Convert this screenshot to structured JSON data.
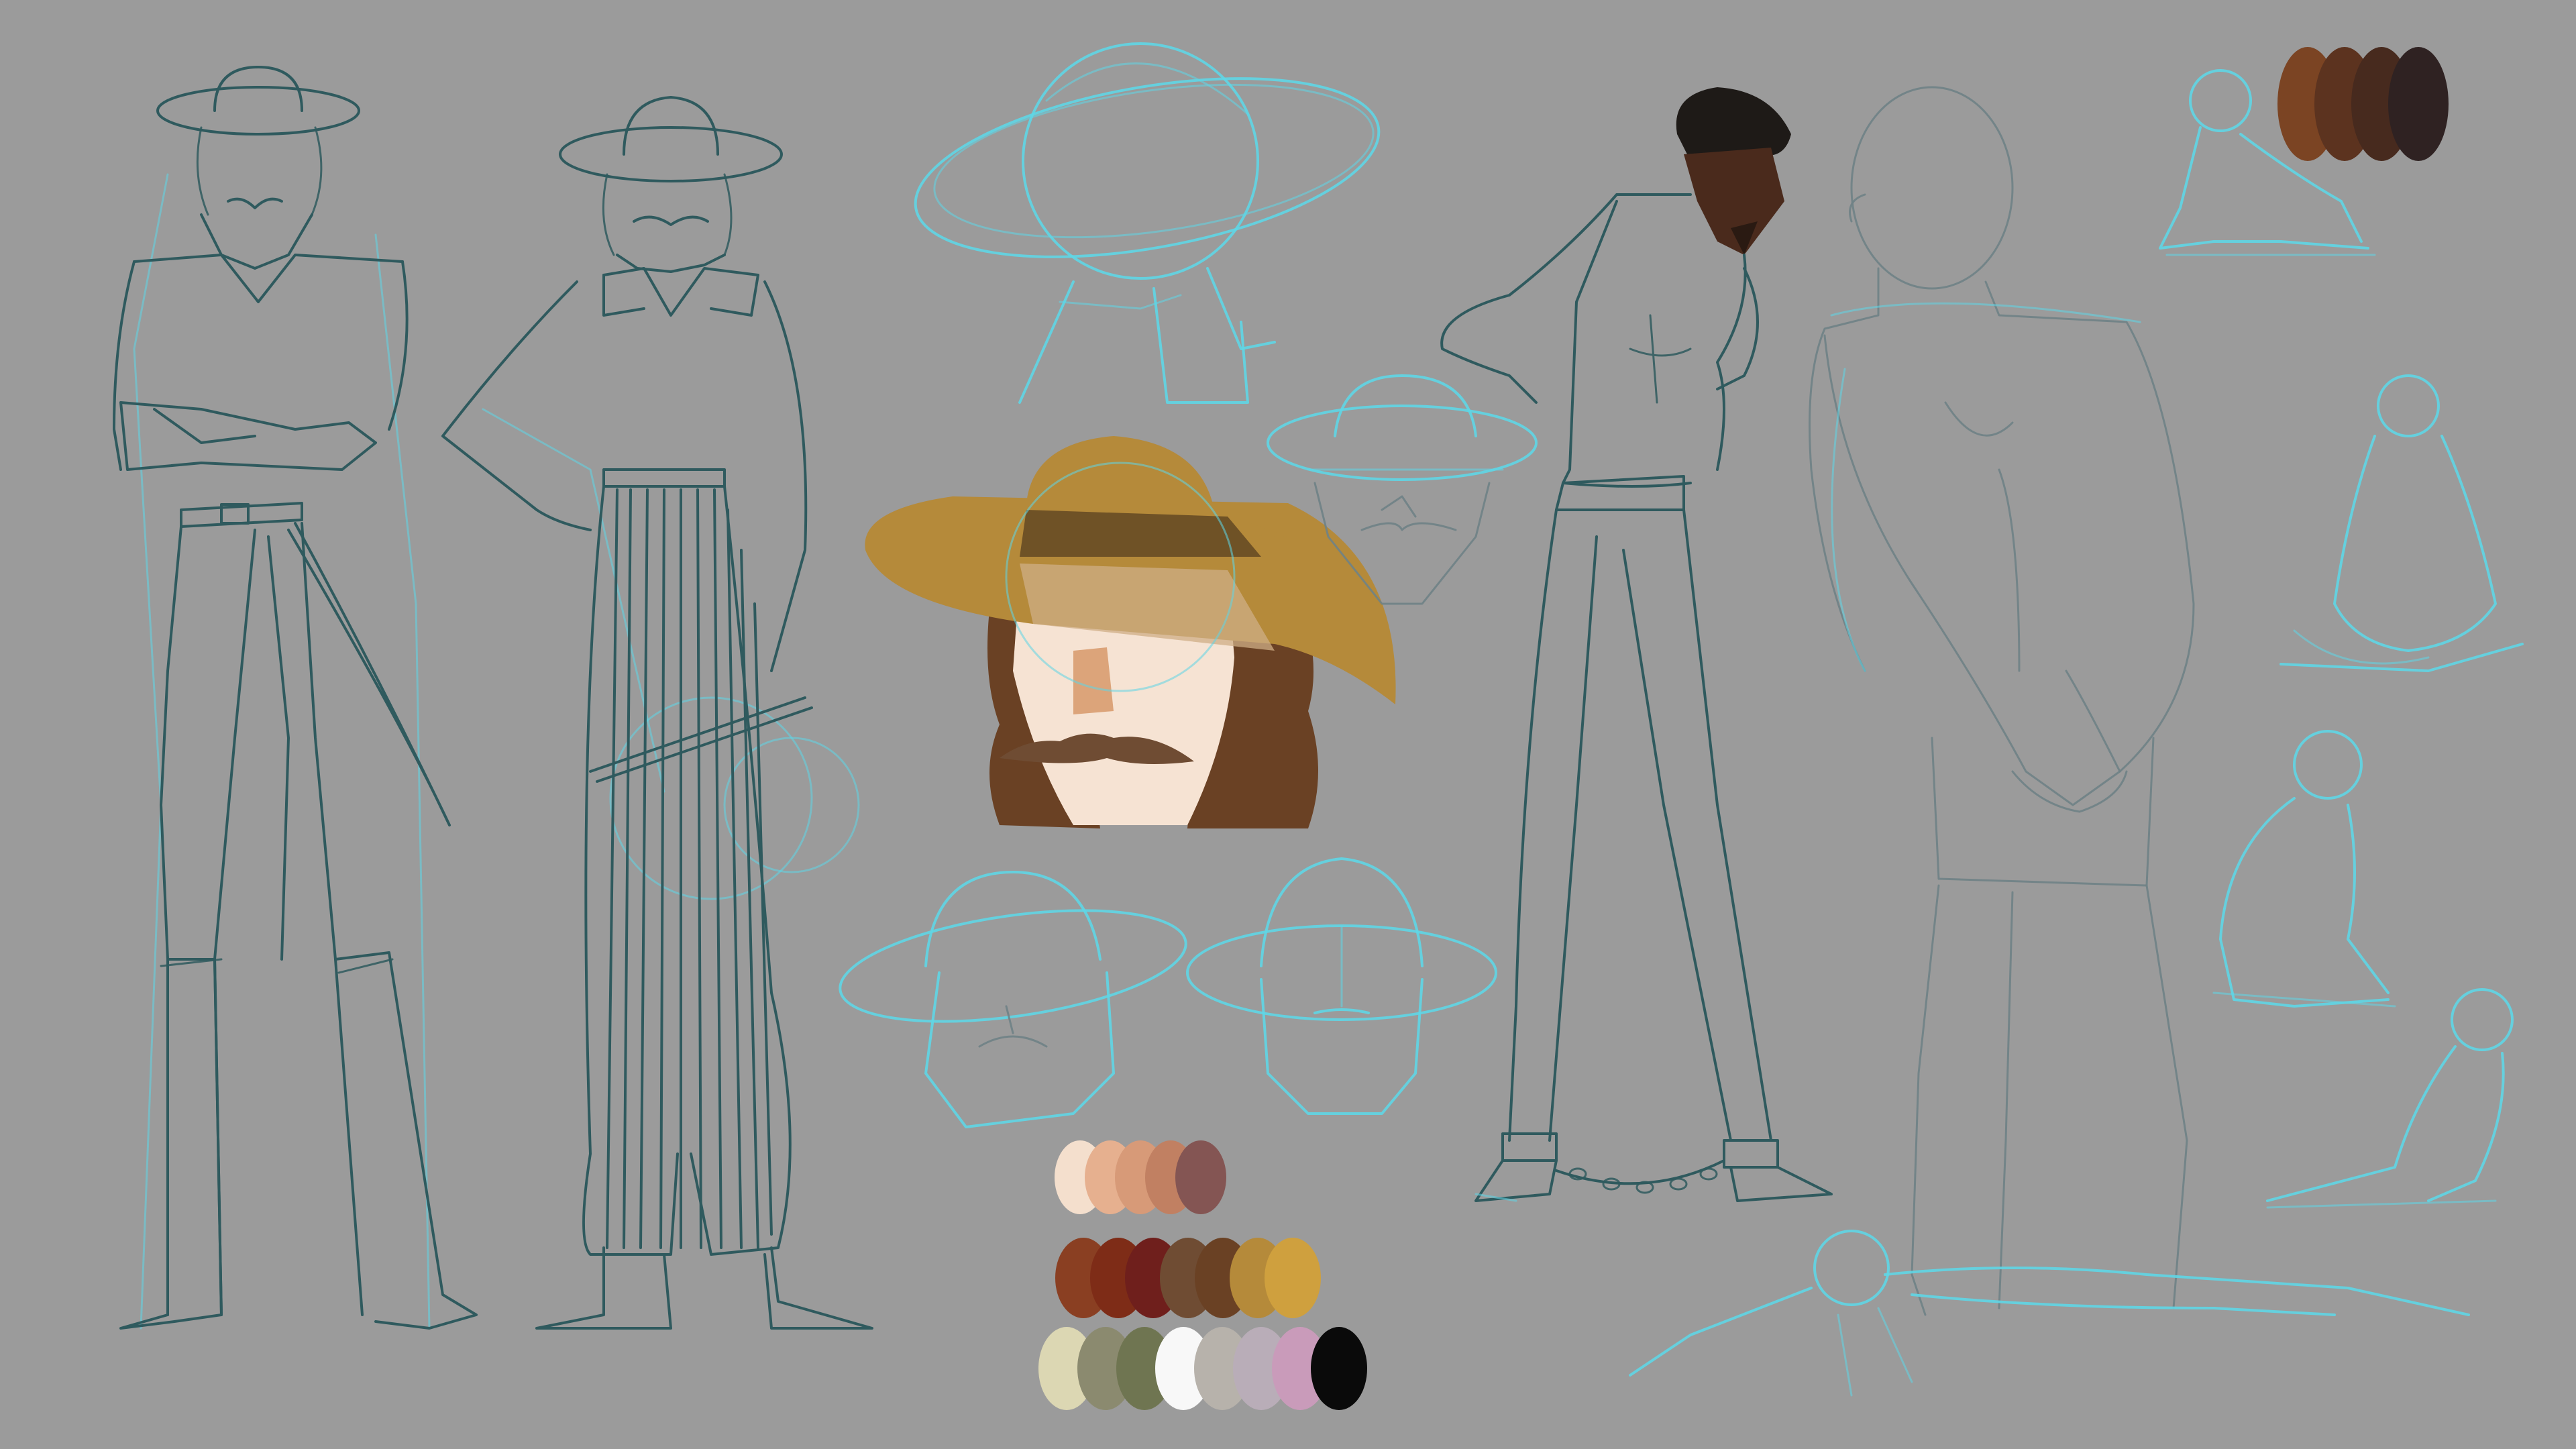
{
  "canvas": {
    "background": "#9b9b9b",
    "sketch_color": "#2f5a5e",
    "guide_color": "#5fd6e6"
  },
  "palettes": {
    "skin_light": [
      "#f4dfcd",
      "#e6b08f",
      "#d79a78",
      "#c18062",
      "#845553"
    ],
    "browns": [
      "#8a3f22",
      "#7e2c17",
      "#6f1f1c",
      "#6f4c33",
      "#6a4124",
      "#b58a3a",
      "#cfa03e"
    ],
    "neutrals": [
      "#dcd7b3",
      "#8b8a6f",
      "#6f7551",
      "#f8f8f8",
      "#b7b2ab",
      "#b9adb8",
      "#c99bba",
      "#0a0a0a"
    ],
    "skin_dark": [
      "#7b4423",
      "#5c331f",
      "#472a1e",
      "#2f2222"
    ]
  },
  "colored_head": {
    "hat": "#b58a3a",
    "hat_band": "#6f5226",
    "hair": "#6a4124",
    "face": "#f6e3d3",
    "nose": "#dca47a",
    "mustache": "#6f4c33"
  },
  "dark_figure": {
    "skin": "#4a2a1c",
    "hair": "#1e1a17"
  },
  "figures": [
    {
      "name": "hat-man-arms-crossed"
    },
    {
      "name": "hat-man-striped-trousers"
    },
    {
      "name": "chained-man-standing"
    },
    {
      "name": "man-back-view"
    }
  ]
}
